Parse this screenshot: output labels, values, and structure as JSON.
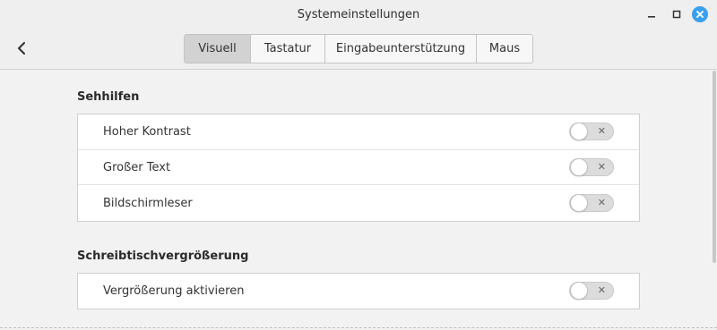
{
  "window": {
    "title": "Systemeinstellungen",
    "controls": [
      "minimize-icon",
      "maximize-icon",
      "close-icon"
    ],
    "close_color": "#3aa0ec"
  },
  "header": {
    "back_icon": "chevron-left-icon",
    "tabs": [
      {
        "label": "Visuell",
        "active": true
      },
      {
        "label": "Tastatur",
        "active": false
      },
      {
        "label": "Eingabeunterstützung",
        "active": false
      },
      {
        "label": "Maus",
        "active": false
      }
    ]
  },
  "sections": [
    {
      "title": "Sehhilfen",
      "rows": [
        {
          "label": "Hoher Kontrast",
          "enabled": false
        },
        {
          "label": "Großer Text",
          "enabled": false
        },
        {
          "label": "Bildschirmleser",
          "enabled": false
        }
      ]
    },
    {
      "title": "Schreibtischvergrößerung",
      "rows": [
        {
          "label": "Vergrößerung aktivieren",
          "enabled": false
        }
      ]
    }
  ],
  "switch_off_glyph": "✕"
}
